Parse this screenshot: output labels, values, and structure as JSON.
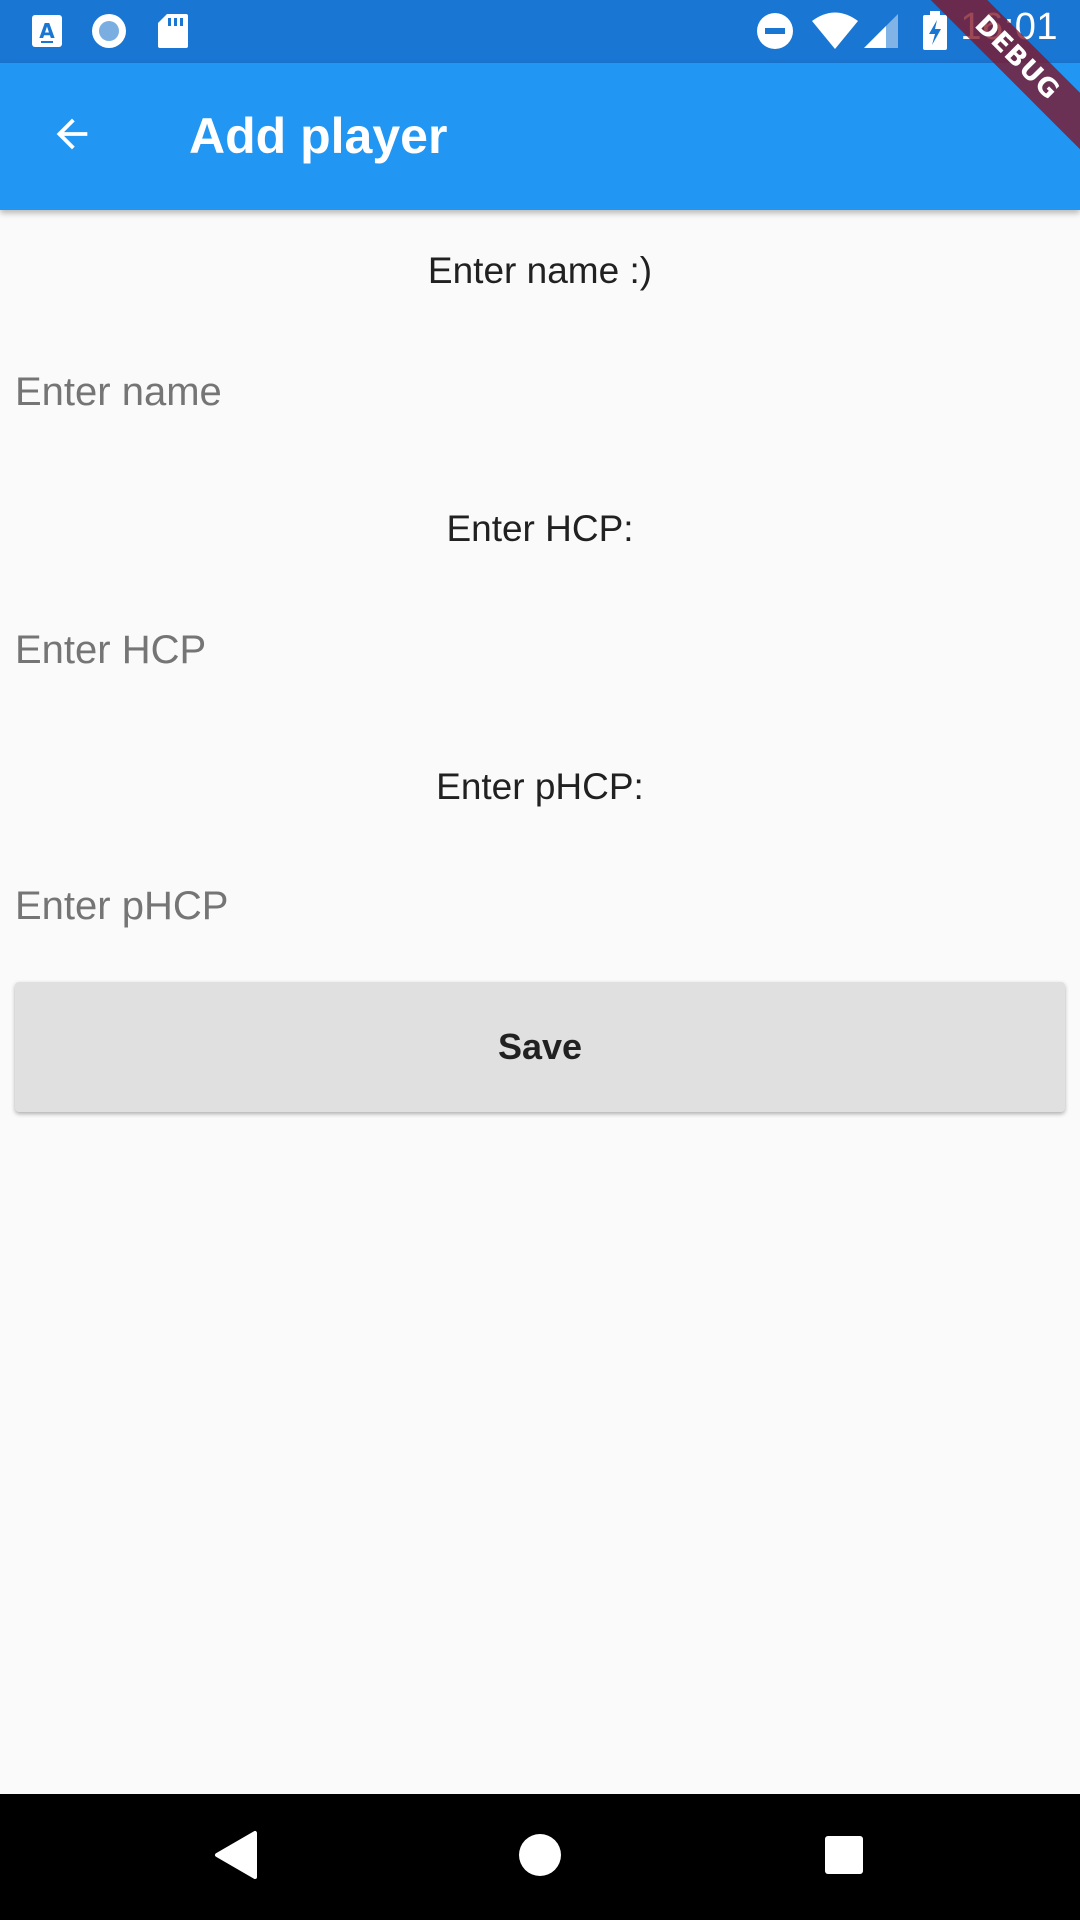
{
  "status_bar": {
    "time": "16:01",
    "left_icons": [
      "text-a-notification-icon",
      "record-notification-icon",
      "sd-card-icon"
    ],
    "right_icons": [
      "do-not-disturb-icon",
      "wifi-icon",
      "signal-icon",
      "battery-charging-icon"
    ]
  },
  "debug_banner": {
    "label": "DEBUG"
  },
  "app_bar": {
    "title": "Add player",
    "back_icon": "arrow-back-icon"
  },
  "form": {
    "name_label": "Enter name :)",
    "name_placeholder": "Enter name",
    "name_value": "",
    "hcp_label": "Enter HCP:",
    "hcp_placeholder": "Enter HCP",
    "hcp_value": "",
    "phcp_label": "Enter pHCP:",
    "phcp_placeholder": "Enter pHCP",
    "phcp_value": "",
    "save_label": "Save"
  },
  "nav_bar": {
    "icons": [
      "nav-back-icon",
      "nav-home-icon",
      "nav-recents-icon"
    ]
  },
  "colors": {
    "status_bar": "#1976d2",
    "app_bar": "#2196f3",
    "background": "#fafafa",
    "button": "#e0e0e0",
    "nav_bar": "#000000"
  }
}
